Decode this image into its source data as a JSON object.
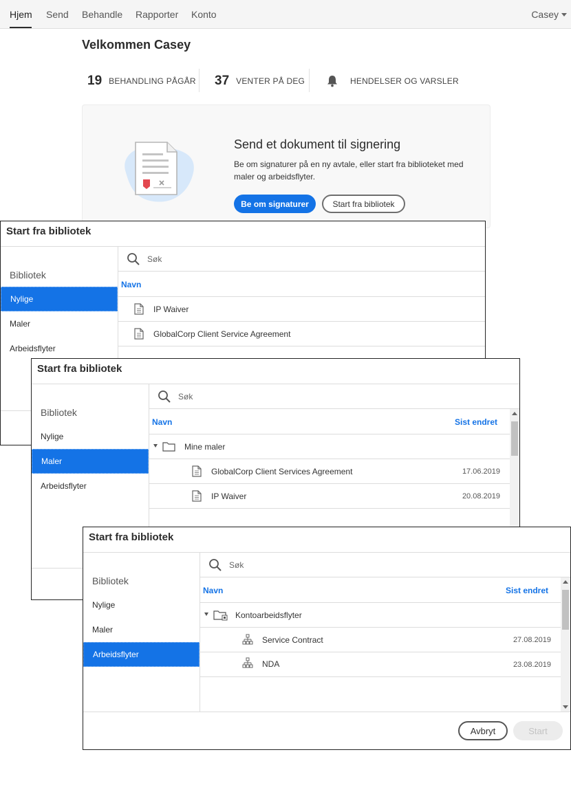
{
  "nav": {
    "tabs": [
      {
        "label": "Hjem",
        "active": true
      },
      {
        "label": "Send"
      },
      {
        "label": "Behandle"
      },
      {
        "label": "Rapporter"
      },
      {
        "label": "Konto"
      }
    ],
    "user": "Casey"
  },
  "dashboard": {
    "welcome": "Velkommen Casey",
    "stats": [
      {
        "count": "19",
        "label": "BEHANDLING PÅGÅR"
      },
      {
        "count": "37",
        "label": "VENTER PÅ DEG"
      },
      {
        "count": "",
        "label": "HENDELSER OG VARSLER",
        "icon": "bell-icon"
      }
    ],
    "send_card": {
      "title": "Send et dokument til signering",
      "description": "Be om signaturer på en ny avtale, eller start fra biblioteket med maler og arbeidsflyter.",
      "primary_button": "Be om signaturer",
      "secondary_button": "Start fra bibliotek"
    }
  },
  "library_dialogs": [
    {
      "title": "Start fra bibliotek",
      "sidebar_heading": "Bibliotek",
      "sidebar_items": [
        "Nylige",
        "Maler",
        "Arbeidsflyter"
      ],
      "active_item": "Nylige",
      "search_placeholder": "Søk",
      "columns": {
        "name": "Navn"
      },
      "rows": [
        {
          "name": "IP Waiver",
          "icon": "document-icon"
        },
        {
          "name": "GlobalCorp Client Service Agreement",
          "icon": "document-icon"
        }
      ]
    },
    {
      "title": "Start fra bibliotek",
      "sidebar_heading": "Bibliotek",
      "sidebar_items": [
        "Nylige",
        "Maler",
        "Arbeidsflyter"
      ],
      "active_item": "Maler",
      "search_placeholder": "Søk",
      "columns": {
        "name": "Navn",
        "modified": "Sist endret"
      },
      "folder": {
        "name": "Mine maler",
        "icon": "folder-icon"
      },
      "rows": [
        {
          "name": "GlobalCorp Client Services Agreement",
          "date": "17.06.2019",
          "icon": "document-icon"
        },
        {
          "name": "IP Waiver",
          "date": "20.08.2019",
          "icon": "document-icon"
        }
      ]
    },
    {
      "title": "Start fra bibliotek",
      "sidebar_heading": "Bibliotek",
      "sidebar_items": [
        "Nylige",
        "Maler",
        "Arbeidsflyter"
      ],
      "active_item": "Arbeidsflyter",
      "search_placeholder": "Søk",
      "columns": {
        "name": "Navn",
        "modified": "Sist endret"
      },
      "folder": {
        "name": "Kontoarbeidsflyter",
        "icon": "shared-folder-icon"
      },
      "rows": [
        {
          "name": "Service Contract",
          "date": "27.08.2019",
          "icon": "workflow-icon"
        },
        {
          "name": "NDA",
          "date": "23.08.2019",
          "icon": "workflow-icon"
        }
      ],
      "footer": {
        "cancel": "Avbryt",
        "start": "Start"
      }
    }
  ],
  "colors": {
    "accent": "#1473e6",
    "text": "#2c2c2c",
    "border": "#dcdcdc"
  }
}
